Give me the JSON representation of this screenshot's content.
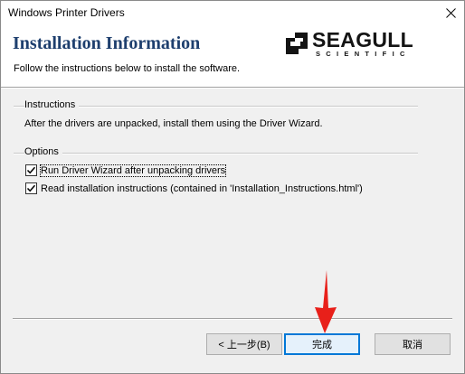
{
  "window": {
    "title": "Windows Printer Drivers"
  },
  "header": {
    "heading": "Installation Information",
    "subtitle": "Follow the instructions below to install the software.",
    "logo": {
      "brand": "SEAGULL",
      "brand_sub": "SCIENTIFIC"
    }
  },
  "instructions": {
    "label": "Instructions",
    "text": "After the drivers are unpacked, install them using the Driver Wizard."
  },
  "options": {
    "label": "Options",
    "items": [
      {
        "label": "Run Driver Wizard after unpacking drivers",
        "checked": true
      },
      {
        "label": "Read installation instructions (contained in 'Installation_Instructions.html')",
        "checked": true
      }
    ]
  },
  "buttons": {
    "back": "< 上一步(B)",
    "finish": "完成",
    "cancel": "取消"
  },
  "annotation": {
    "arrow_color": "#e8201a"
  },
  "colors": {
    "heading": "#1e3f6e",
    "default_button_border": "#0078d7"
  }
}
